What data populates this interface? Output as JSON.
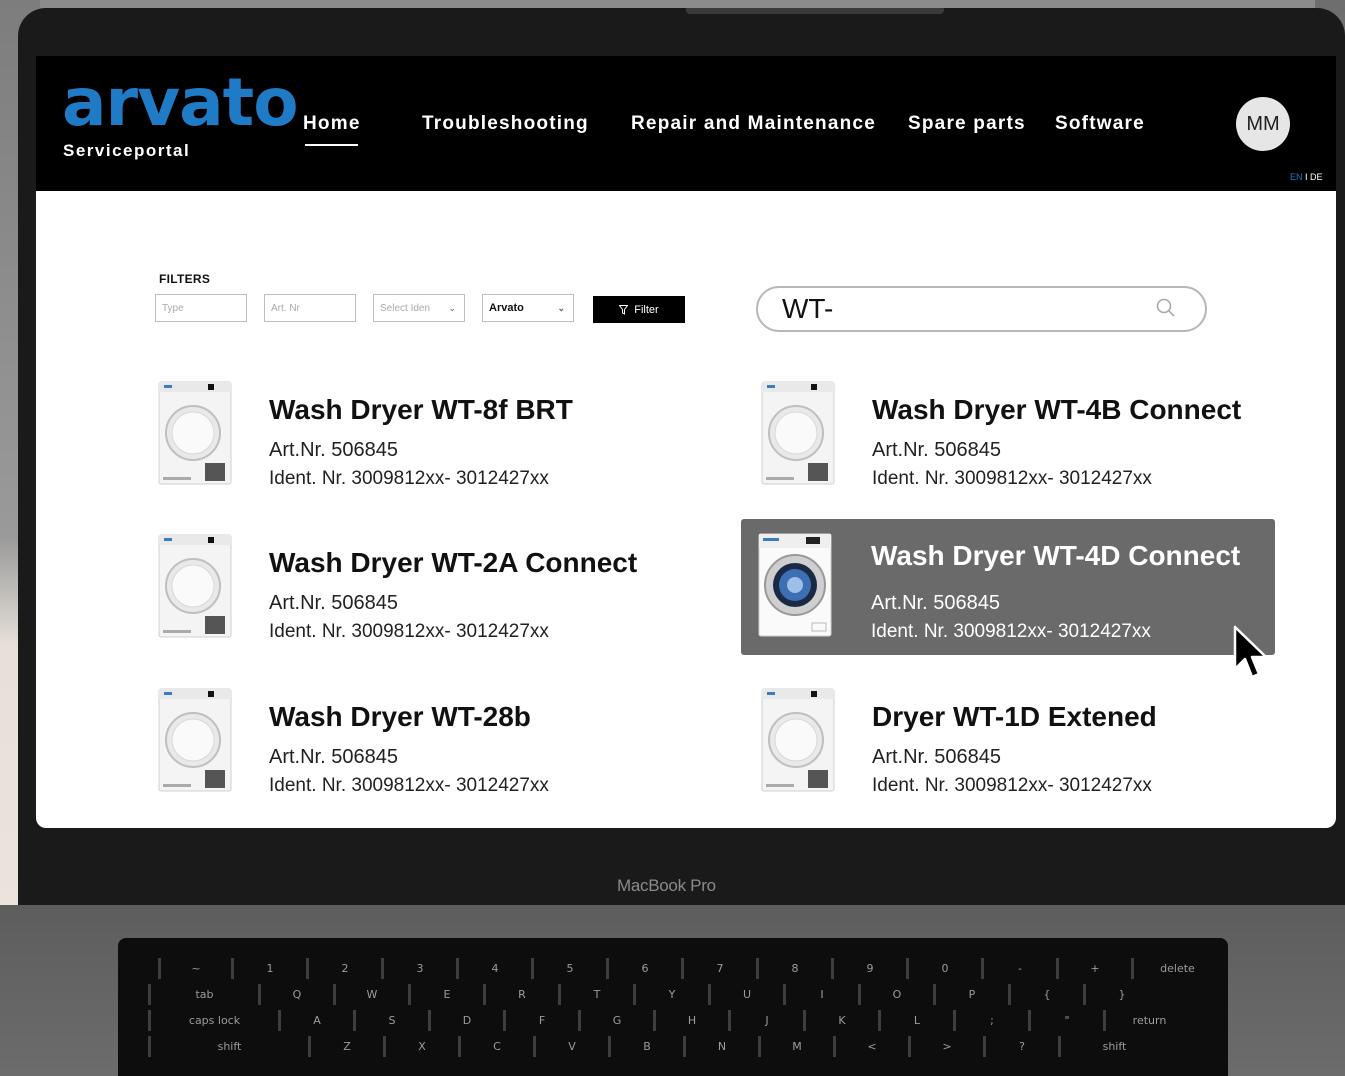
{
  "app": {
    "logo_word": "arvato",
    "logo_sub": "Serviceportal"
  },
  "nav": {
    "items": [
      "Home",
      "Troubleshooting",
      "Repair and Maintenance",
      "Spare parts",
      "Software"
    ],
    "active": "Home",
    "avatar_initials": "MM",
    "lang_en": "EN",
    "lang_sep": " I ",
    "lang_de": "DE"
  },
  "filters": {
    "title": "FILTERS",
    "type_placeholder": "Type",
    "artnr_placeholder": "Art. Nr",
    "ident_select": "Select Iden",
    "brand_select": "Arvato",
    "button_label": "Filter"
  },
  "search": {
    "value": "WT-",
    "icon": "search-icon"
  },
  "products": [
    {
      "name": "Wash Dryer WT-8f BRT",
      "art": "Art.Nr. 506845",
      "ident": "Ident. Nr. 3009812xx- 3012427xx",
      "selected": false,
      "image": "dryer"
    },
    {
      "name": "Wash Dryer WT-4B Connect",
      "art": "Art.Nr. 506845",
      "ident": "Ident. Nr. 3009812xx- 3012427xx",
      "selected": false,
      "image": "dryer"
    },
    {
      "name": "Wash Dryer WT-2A Connect",
      "art": "Art.Nr. 506845",
      "ident": "Ident. Nr. 3009812xx- 3012427xx",
      "selected": false,
      "image": "dryer"
    },
    {
      "name": "Wash Dryer WT-4D Connect",
      "art": "Art.Nr. 506845",
      "ident": "Ident. Nr. 3009812xx- 3012427xx",
      "selected": true,
      "image": "washer"
    },
    {
      "name": "Wash Dryer WT-28b",
      "art": "Art.Nr. 506845",
      "ident": "Ident. Nr. 3009812xx- 3012427xx",
      "selected": false,
      "image": "dryer"
    },
    {
      "name": "Dryer WT-1D Extened",
      "art": "Art.Nr. 506845",
      "ident": "Ident. Nr. 3009812xx- 3012427xx",
      "selected": false,
      "image": "dryer"
    }
  ],
  "device": {
    "label": "MacBook Pro"
  },
  "colors": {
    "brand_blue": "#1f7bc6",
    "nav_bg": "#000000",
    "selected_card": "#6a6a6a"
  }
}
